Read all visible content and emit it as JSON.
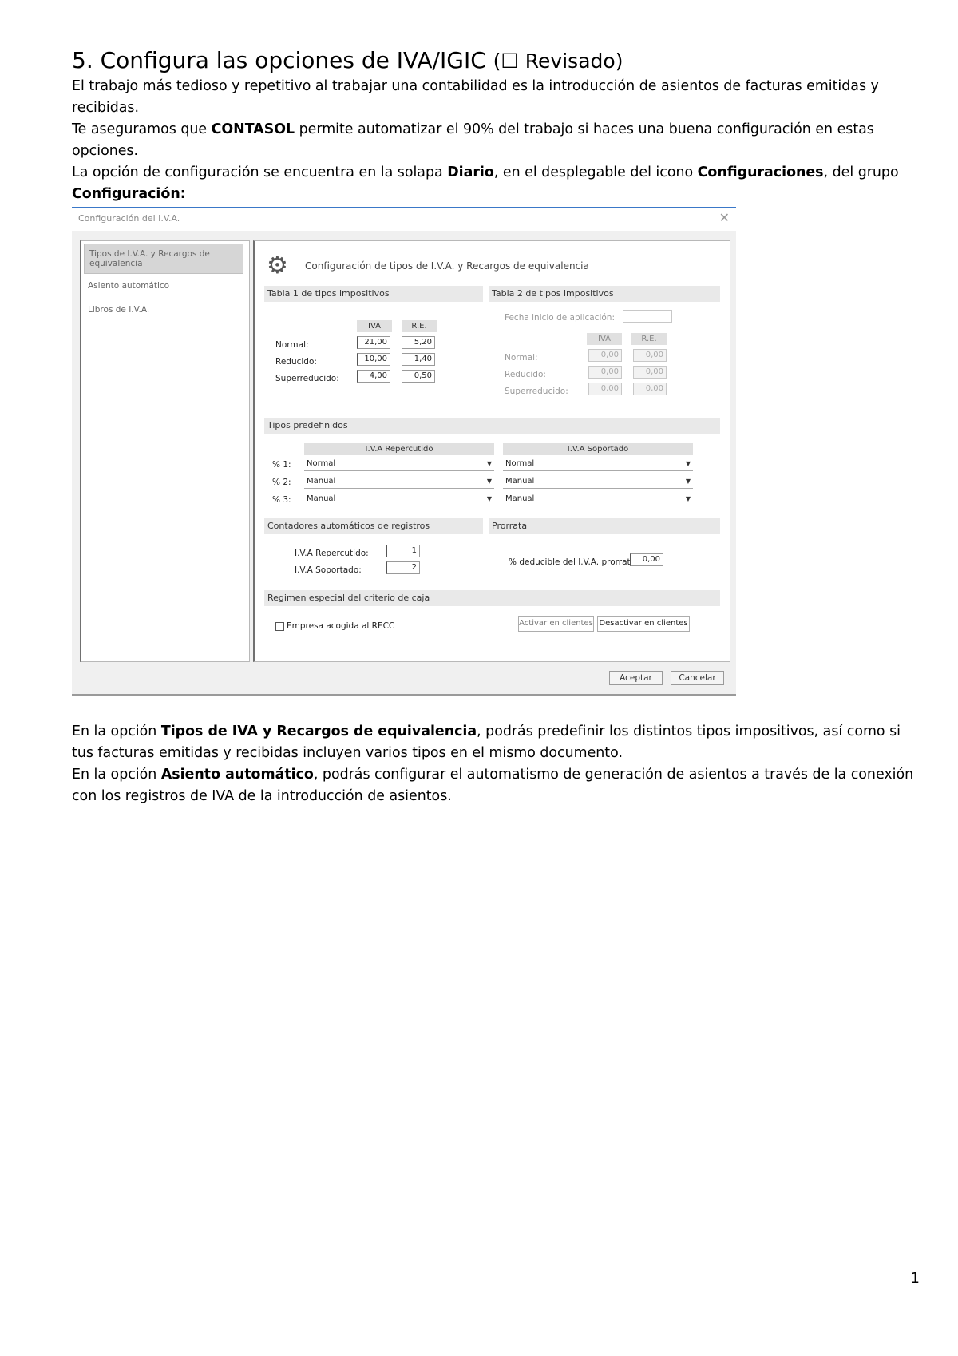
{
  "heading": {
    "number": "5.",
    "title": "Configura las opciones de IVA/IGIC",
    "checkbox_glyph": "☐",
    "status": "Revisado"
  },
  "intro": {
    "p1": "El trabajo más tedioso y repetitivo al trabajar una contabilidad es la introducción de asientos de facturas emitidas y recibidas.",
    "p2_a": "Te aseguramos que ",
    "p2_b": "CONTASOL",
    "p2_c": " permite automatizar el 90% del trabajo si haces una buena configuración en estas opciones.",
    "p3_a": "La opción de configuración se encuentra en la solapa ",
    "p3_b": "Diario",
    "p3_c": ", en el desplegable del icono ",
    "p3_d": "Configuraciones",
    "p3_e": ", del grupo ",
    "p3_f": "Configuración:"
  },
  "dialog": {
    "title": "Configuración del I.V.A.",
    "close": "✕",
    "sidebar": [
      "Tipos de I.V.A. y Recargos de equivalencia",
      "Asiento automático",
      "Libros de I.V.A."
    ],
    "main_title": "Configuración de tipos de I.V.A. y Recargos de equivalencia",
    "table1": {
      "header": "Tabla 1 de tipos impositivos",
      "col_iva": "IVA",
      "col_re": "R.E.",
      "rows": [
        {
          "label": "Normal:",
          "iva": "21,00",
          "re": "5,20"
        },
        {
          "label": "Reducido:",
          "iva": "10,00",
          "re": "1,40"
        },
        {
          "label": "Superreducido:",
          "iva": "4,00",
          "re": "0,50"
        }
      ]
    },
    "table2": {
      "header": "Tabla 2 de tipos impositivos",
      "date_label": "Fecha inicio de aplicación:",
      "col_iva": "IVA",
      "col_re": "R.E.",
      "rows": [
        {
          "label": "Normal:",
          "iva": "0,00",
          "re": "0,00"
        },
        {
          "label": "Reducido:",
          "iva": "0,00",
          "re": "0,00"
        },
        {
          "label": "Superreducido:",
          "iva": "0,00",
          "re": "0,00"
        }
      ]
    },
    "predef": {
      "header": "Tipos predefinidos",
      "col_rep": "I.V.A Repercutido",
      "col_sop": "I.V.A Soportado",
      "rows": [
        {
          "label": "% 1:",
          "rep": "Normal",
          "sop": "Normal"
        },
        {
          "label": "% 2:",
          "rep": "Manual",
          "sop": "Manual"
        },
        {
          "label": "% 3:",
          "rep": "Manual",
          "sop": "Manual"
        }
      ]
    },
    "counters": {
      "header": "Contadores automáticos de registros",
      "rep_label": "I.V.A Repercutido:",
      "rep_value": "1",
      "sop_label": "I.V.A Soportado:",
      "sop_value": "2"
    },
    "prorrata": {
      "header": "Prorrata",
      "label": "% deducible del I.V.A. prorrata",
      "value": "0,00"
    },
    "recc": {
      "header": "Regimen especial del criterio de caja",
      "checkbox_label": "Empresa acogida al RECC",
      "btn_activate": "Activar en clientes",
      "btn_deactivate": "Desactivar en clientes"
    },
    "footer": {
      "accept": "Aceptar",
      "cancel": "Cancelar"
    }
  },
  "after": {
    "p1_a": "En la opción ",
    "p1_b": "Tipos de IVA y Recargos de equivalencia",
    "p1_c": ", podrás predefinir los distintos tipos impositivos, así como si tus facturas emitidas y recibidas incluyen varios tipos en el mismo documento.",
    "p2_a": "En la opción ",
    "p2_b": "Asiento automático",
    "p2_c": ", podrás configurar el automatismo de generación de asientos a través de la conexión con los registros de IVA de la introducción de asientos."
  },
  "page_number": "1"
}
